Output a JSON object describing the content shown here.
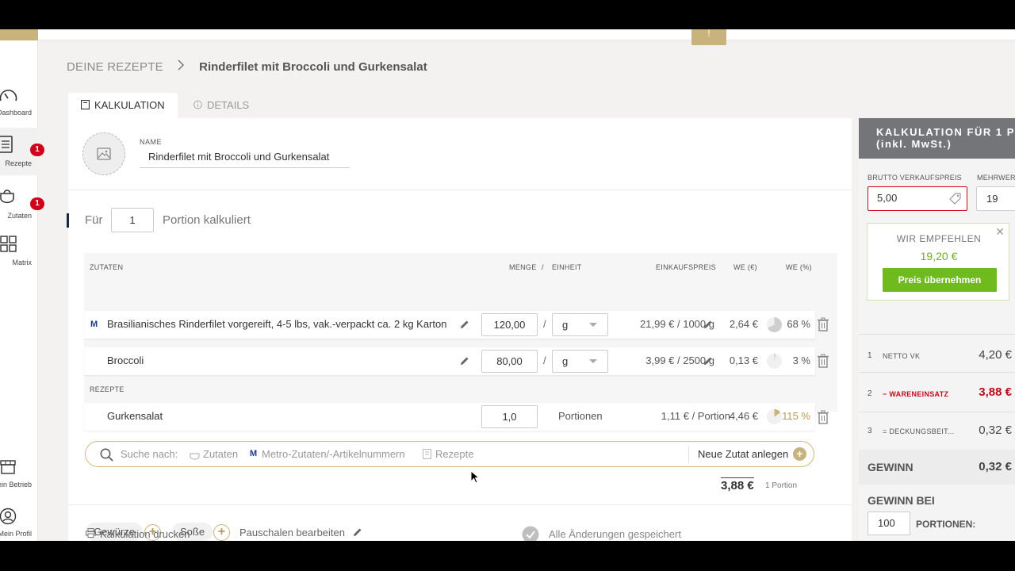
{
  "breadcrumb": {
    "root": "DEINE REZEPTE",
    "current": "Rinderfilet mit Broccoli und Gurkensalat"
  },
  "tabs": [
    {
      "label": "KALKULATION"
    },
    {
      "label": "DETAILS"
    }
  ],
  "sidebar": {
    "items": [
      {
        "label": "Dashboard",
        "icon": "speedometer-icon"
      },
      {
        "label": "Rezepte",
        "icon": "document-icon",
        "badge": "1"
      },
      {
        "label": "Zutaten",
        "icon": "pot-icon",
        "badge": "1"
      },
      {
        "label": "Matrix",
        "icon": "grid-icon"
      },
      {
        "label": "Mein Betrieb",
        "icon": "store-icon"
      },
      {
        "label": "Mein Profil",
        "icon": "user-icon"
      }
    ]
  },
  "recipe": {
    "name_label": "NAME",
    "name": "Rinderfilet mit Broccoli und Gurkensalat"
  },
  "portion": {
    "prefix": "Für",
    "value": "1",
    "suffix": "Portion kalkuliert"
  },
  "columns": {
    "zutaten": "ZUTATEN",
    "menge": "MENGE",
    "slash": "/",
    "einheit": "EINHEIT",
    "einkaufspreis": "EINKAUFSPREIS",
    "we_eur": "WE (€)",
    "we_pct": "WE (%)"
  },
  "ingredients": [
    {
      "name": "Brasilianisches Rinderfilet vorgereift, 4-5 lbs, vak.-verpackt ca. 2 kg Karton",
      "metro": "M",
      "menge": "120,00",
      "einheit": "g",
      "preis": "21,99 € / 1000 g",
      "we_eur": "2,64 €",
      "we_pct": "68 %",
      "pct_value": 68
    },
    {
      "name": "Broccoli",
      "menge": "80,00",
      "einheit": "g",
      "preis": "3,99 € / 2500 g",
      "we_eur": "0,13 €",
      "we_pct": "3 %",
      "pct_value": 3
    }
  ],
  "rezepte_label": "REZEPTE",
  "sub_recipes": [
    {
      "name": "Gurkensalat",
      "menge": "1,0",
      "einheit": "Portionen",
      "preis": "1,11 € / Portion",
      "we_eur": "4,46 €",
      "we_pct": "115 %",
      "pct_value": 115
    }
  ],
  "search": {
    "label": "Suche nach:",
    "opt1": "Zutaten",
    "opt2": "Metro-Zutaten/-Artikelnummern",
    "opt3": "Rezepte",
    "new_label": "Neue Zutat anlegen"
  },
  "total": {
    "value": "3,88 €",
    "sub": "1 Portion"
  },
  "extras": {
    "chip1": "Gewürze",
    "chip2": "Soße",
    "pauschalen": "Pauschalen bearbeiten"
  },
  "footer": {
    "print": "Kalkulation drucken",
    "saved": "Alle Änderungen gespeichert"
  },
  "right": {
    "title_line1": "KALKULATION FÜR 1 P",
    "title_line2": "(inkl. MwSt.)",
    "brutto_label": "BRUTTO VERKAUFSPREIS",
    "brutto_value": "5,00",
    "mwst_label": "MEHRWER",
    "mwst_value": "19",
    "recommend_title": "WIR EMPFEHLEN",
    "recommend_value": "19,20 €",
    "recommend_button": "Preis übernehmen",
    "rows": [
      {
        "num": "1",
        "label": "NETTO VK",
        "value": "4,20 €"
      },
      {
        "num": "2",
        "label": "− WARENEINSATZ",
        "value": "3,88 €"
      },
      {
        "num": "3",
        "label": "= DECKUNGSBEIT...",
        "value": "0,32 €"
      }
    ],
    "gewinn_label": "GEWINN",
    "gewinn_value": "0,32 €",
    "gewinn_bei_label": "GEWINN BEI",
    "gewinn_bei_value": "100",
    "portionen_label": "PORTIONEN:"
  },
  "colors": {
    "accent_gold": "#c9b37c",
    "alert_red": "#d0021b",
    "success_green": "#6fbb1e",
    "panel_header": "#737579"
  },
  "top_tab_glyph": "!"
}
